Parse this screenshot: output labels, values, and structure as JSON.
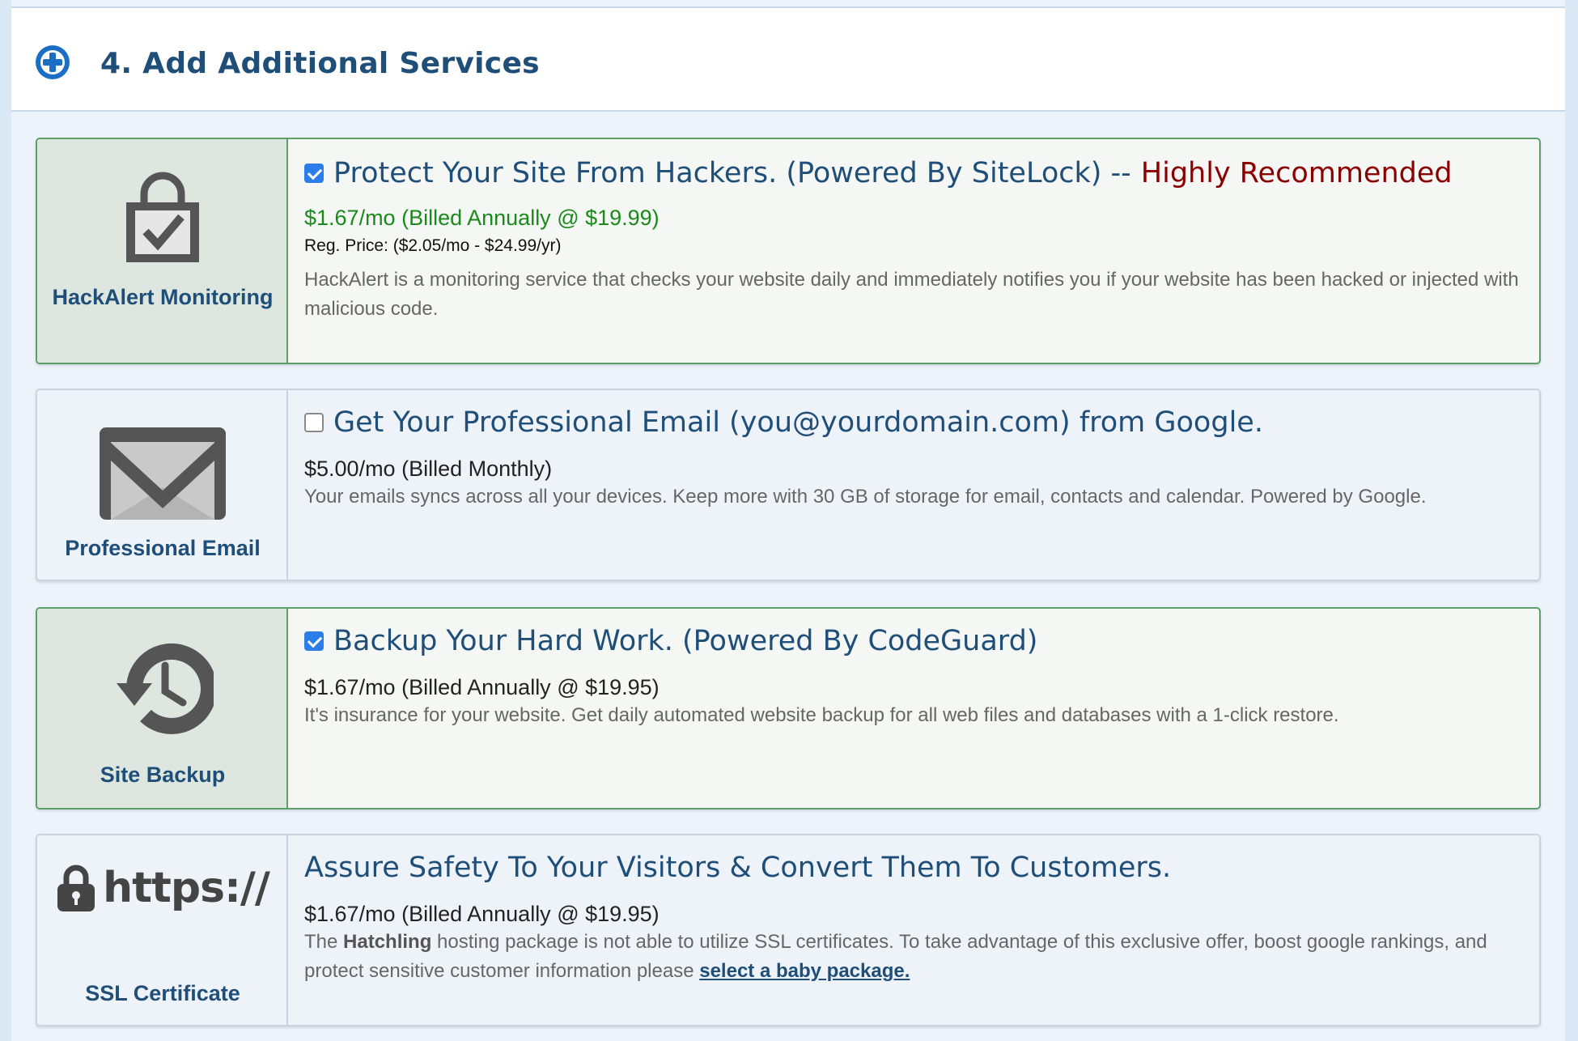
{
  "section": {
    "title": "4. Add Additional Services"
  },
  "services": [
    {
      "label": "HackAlert Monitoring",
      "selected": true,
      "icon": "lock-check-icon",
      "headline": "Protect Your Site From Hackers. (Powered By SiteLock) --",
      "recommend": "Highly Recommended",
      "price": "$1.67/mo (Billed Annually @ $19.99)",
      "reg_price": "Reg. Price: ($2.05/mo - $24.99/yr)",
      "description": "HackAlert is a monitoring service that checks your website daily and immediately notifies you if your website has been hacked or injected with malicious code."
    },
    {
      "label": "Professional Email",
      "selected": false,
      "icon": "email-envelope-icon",
      "headline": "Get Your Professional Email (you@yourdomain.com) from Google.",
      "price": "$5.00/mo (Billed Monthly)",
      "description": "Your emails syncs across all your devices. Keep more with 30 GB of storage for email, contacts and calendar. Powered by Google."
    },
    {
      "label": "Site Backup",
      "selected": true,
      "icon": "backup-history-icon",
      "headline": "Backup Your Hard Work. (Powered By CodeGuard)",
      "price": "$1.67/mo (Billed Annually @ $19.95)",
      "description": "It's insurance for your website. Get daily automated website backup for all web files and databases with a 1-click restore."
    },
    {
      "label": "SSL Certificate",
      "selected": false,
      "icon": "lock-https-icon",
      "icon_text": "https://",
      "headline": "Assure Safety To Your Visitors & Convert Them To Customers.",
      "price": "$1.67/mo (Billed Annually @ $19.95)",
      "description_pre": "The",
      "description_bold": "Hatchling",
      "description_post": "hosting package is not able to utilize SSL certificates. To take advantage of this exclusive offer, boost google rankings, and protect sensitive customer information please",
      "link": "select a baby package."
    }
  ],
  "colors": {
    "accent_blue": "#1f4e79",
    "checkbox_blue": "#2b7de9",
    "price_green": "#1a8a1a",
    "recommend_red": "#8b0000",
    "selected_border": "#5e9e6c"
  }
}
